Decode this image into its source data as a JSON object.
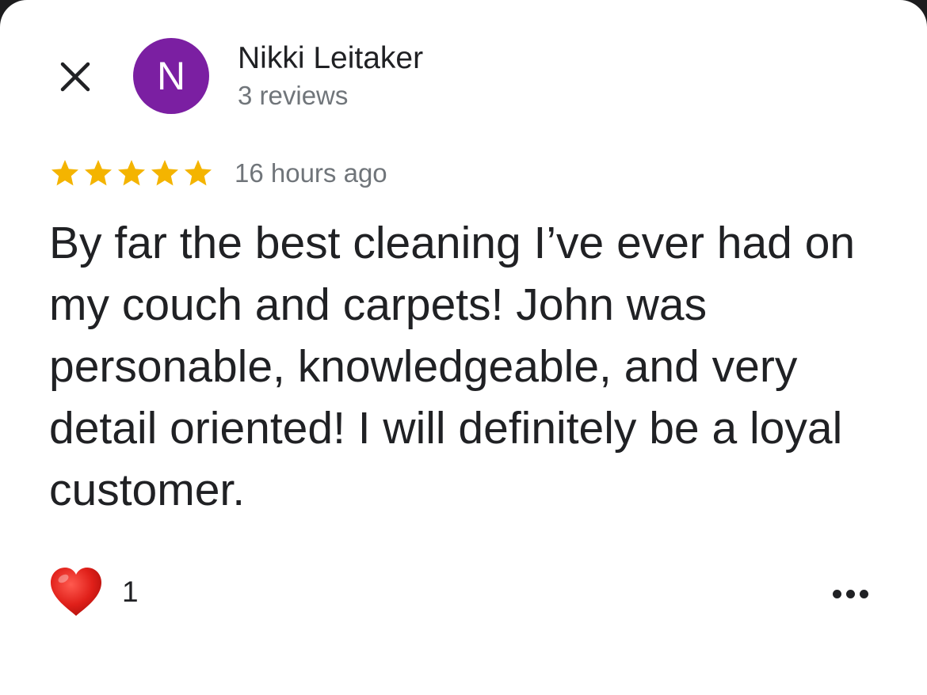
{
  "reviewer": {
    "avatar_initial": "N",
    "avatar_color": "#7b1fa2",
    "name": "Nikki Leitaker",
    "review_count": "3 reviews"
  },
  "review": {
    "rating": 5,
    "rating_max": 5,
    "star_color": "#f4b400",
    "time_ago": "16 hours ago",
    "text": "By far the best cleaning I’ve ever had on my couch and carpets! John was personable, knowledgeable, and very detail oriented! I will definitely be a loyal customer."
  },
  "reactions": {
    "icon": "heart-icon",
    "count": "1"
  },
  "icons": {
    "close": "close-icon",
    "more": "more-horizontal-icon"
  }
}
